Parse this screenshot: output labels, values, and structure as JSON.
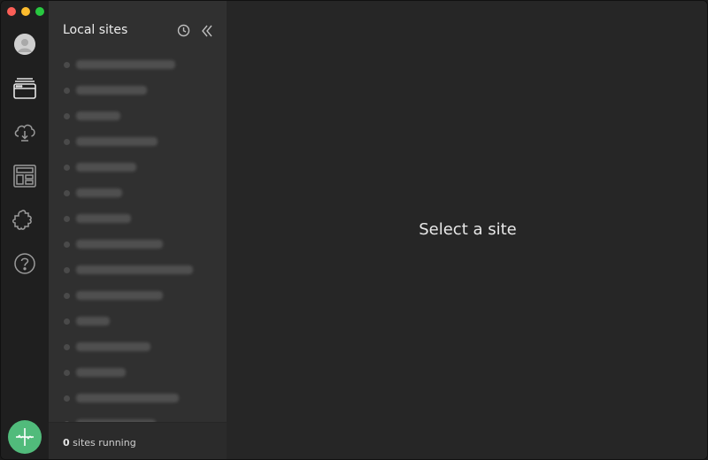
{
  "window": {
    "controls": [
      "close",
      "minimize",
      "maximize"
    ]
  },
  "rail": {
    "icons": [
      "avatar",
      "sites-icon",
      "cloud-download-icon",
      "blueprints-icon",
      "addons-icon",
      "help-icon"
    ],
    "add_button_icon": "plus-icon",
    "accent": "#51bb7b"
  },
  "sidebar": {
    "title": "Local sites",
    "site_count_visible": 15,
    "footer": {
      "count": "0",
      "label": " sites running"
    }
  },
  "main": {
    "empty_message": "Select a site"
  }
}
